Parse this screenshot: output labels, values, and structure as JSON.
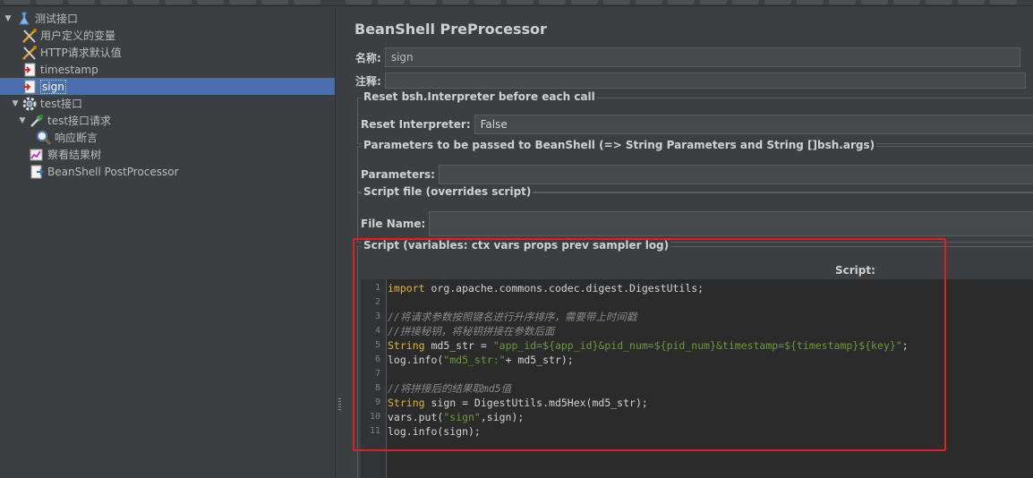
{
  "tree": {
    "items": [
      {
        "label": "测试接口",
        "icon": "test-plan-icon",
        "level": 0,
        "expanded": true
      },
      {
        "label": "用户定义的变量",
        "icon": "config-tool-icon",
        "level": 1
      },
      {
        "label": "HTTP请求默认值",
        "icon": "config-tool-icon",
        "level": 1
      },
      {
        "label": "timestamp",
        "icon": "preprocessor-icon",
        "level": 1
      },
      {
        "label": "sign",
        "icon": "preprocessor-icon",
        "level": 1,
        "selected": true
      },
      {
        "label": "test接口",
        "icon": "thread-group-gear-icon",
        "level": 1,
        "expanded": true
      },
      {
        "label": "test接口请求",
        "icon": "sampler-pipette-icon",
        "level": 2,
        "expanded": true
      },
      {
        "label": "响应断言",
        "icon": "assertion-magnifier-icon",
        "level": 3
      },
      {
        "label": "察看结果树",
        "icon": "listener-chart-icon",
        "level": 2
      },
      {
        "label": "BeanShell PostProcessor",
        "icon": "postprocessor-icon",
        "level": 2
      }
    ]
  },
  "panel": {
    "title": "BeanShell PreProcessor",
    "name_label": "名称:",
    "name_value": "sign",
    "comment_label": "注释:",
    "comment_value": "",
    "reset_group_title": "Reset bsh.Interpreter before each call",
    "reset_label": "Reset Interpreter:",
    "reset_value": "False",
    "params_group_title": "Parameters to be passed to BeanShell (=> String Parameters and String []bsh.args)",
    "params_label": "Parameters:",
    "params_value": "",
    "file_group_title": "Script file (overrides script)",
    "file_label": "File Name:",
    "file_value": "",
    "script_group_title": "Script (variables: ctx vars props prev sampler log)",
    "script_label": "Script:"
  },
  "code": {
    "lines": [
      {
        "n": "1",
        "parts": [
          {
            "t": "import",
            "c": "kw"
          },
          {
            "t": " org.apache.commons.codec.digest.DigestUtils;",
            "c": ""
          }
        ]
      },
      {
        "n": "2",
        "parts": []
      },
      {
        "n": "3",
        "parts": [
          {
            "t": "//将请求参数按照键名进行升序排序，需要带上时间戳",
            "c": "cm"
          }
        ]
      },
      {
        "n": "4",
        "parts": [
          {
            "t": "//拼接秘钥，将秘钥拼接在参数后面",
            "c": "cm"
          }
        ]
      },
      {
        "n": "5",
        "parts": [
          {
            "t": "String",
            "c": "kw"
          },
          {
            "t": " md5_str = ",
            "c": ""
          },
          {
            "t": "\"app_id=${app_id}&pid_num=${pid_num}&timestamp=${timestamp}${key}\"",
            "c": "st"
          },
          {
            "t": ";",
            "c": ""
          }
        ]
      },
      {
        "n": "6",
        "parts": [
          {
            "t": "log.info(",
            "c": ""
          },
          {
            "t": "\"md5_str:\"",
            "c": "st"
          },
          {
            "t": "+ md5_str);",
            "c": ""
          }
        ]
      },
      {
        "n": "7",
        "parts": []
      },
      {
        "n": "8",
        "parts": [
          {
            "t": "//将拼接后的结果取md5值",
            "c": "cm"
          }
        ]
      },
      {
        "n": "9",
        "parts": [
          {
            "t": "String",
            "c": "kw"
          },
          {
            "t": " sign = DigestUtils.md5Hex(md5_str);",
            "c": ""
          }
        ]
      },
      {
        "n": "10",
        "parts": [
          {
            "t": "vars.put(",
            "c": ""
          },
          {
            "t": "\"sign\"",
            "c": "st"
          },
          {
            "t": ",sign);",
            "c": ""
          }
        ]
      },
      {
        "n": "11",
        "parts": [
          {
            "t": "log.info(sign);",
            "c": ""
          }
        ]
      }
    ]
  },
  "colors": {
    "selection": "#4b6eaf",
    "highlight_box": "#e02020",
    "keyword": "#e0b040",
    "string": "#6a9a3a",
    "comment": "#8a8a8a"
  }
}
